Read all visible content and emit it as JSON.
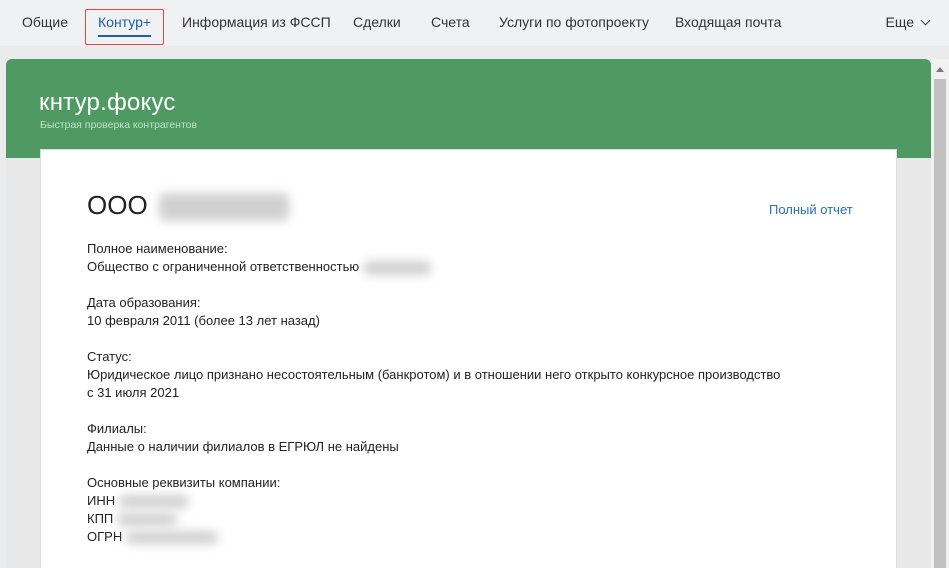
{
  "tabs": [
    {
      "label": "Общие"
    },
    {
      "label": "Контур+"
    },
    {
      "label": "Информация из ФССП"
    },
    {
      "label": "Сделки"
    },
    {
      "label": "Счета"
    },
    {
      "label": "Услуги по фотопроекту"
    },
    {
      "label": "Входящая почта"
    }
  ],
  "more_label": "Еще",
  "widget": {
    "logo": "кнтур.фокус",
    "tagline": "Быстрая проверка контрагентов"
  },
  "company": {
    "prefix": "ООО",
    "full_report": "Полный отчет",
    "fields": [
      {
        "label": "Полное наименование:",
        "value": "Общество с ограниченной ответственностью"
      },
      {
        "label": "Дата образования:",
        "value": "10 февраля 2011 (более 13 лет назад)"
      },
      {
        "label": "Статус:",
        "value": "Юридическое лицо признано несостоятельным (банкротом) и в отношении него открыто конкурсное производство",
        "value2": "с 31 июля 2021"
      },
      {
        "label": "Филиалы:",
        "value": "Данные о наличии филиалов в ЕГРЮЛ не найдены"
      },
      {
        "label": "Основные реквизиты компании:",
        "inn": "ИНН",
        "kpp": "КПП",
        "ogrn": "ОГРН"
      }
    ]
  },
  "colors": {
    "accent": "#1f5fa8",
    "header_green": "#4f9a63",
    "link": "#2e6db4",
    "highlight": "#e04646"
  }
}
